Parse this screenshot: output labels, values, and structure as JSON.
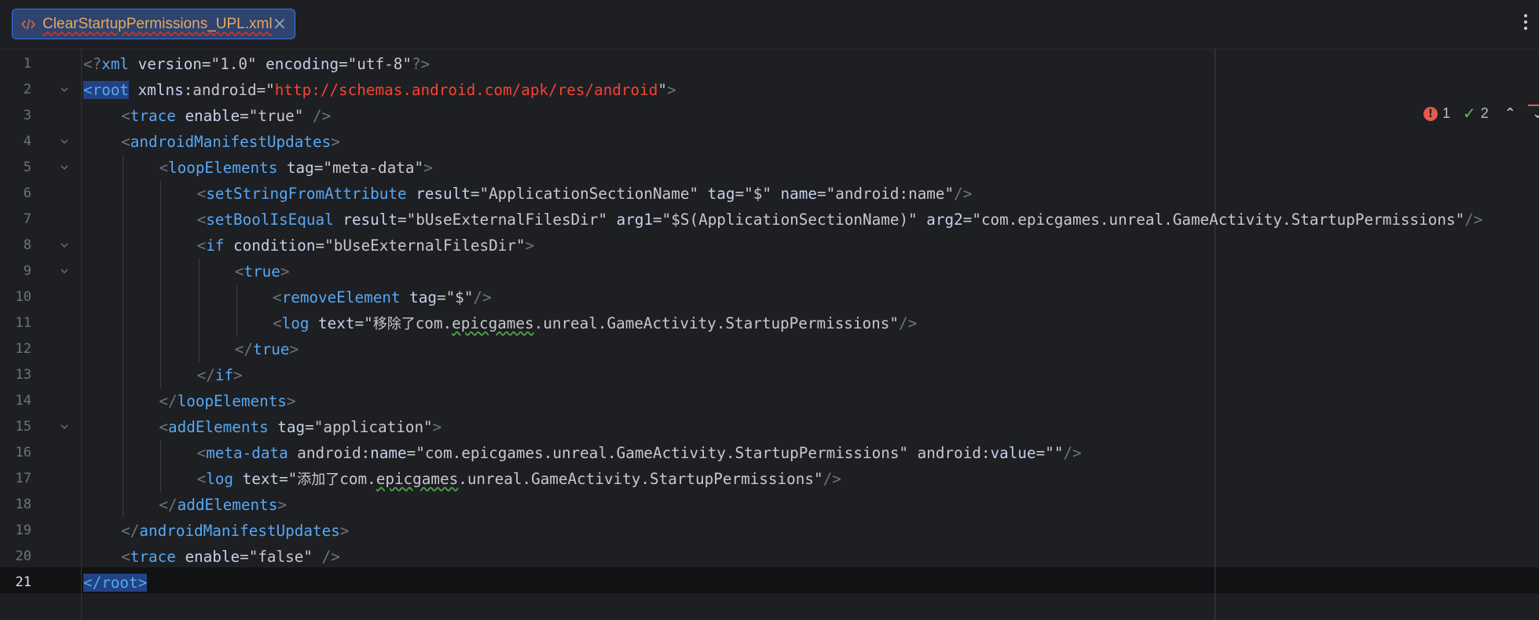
{
  "tab": {
    "title": "ClearStartupPermissions_UPL.xml",
    "close": "×"
  },
  "inspection": {
    "errors": "1",
    "warnings": "2",
    "error_glyph": "!",
    "ok_glyph": "✓",
    "prev": "⌃",
    "next": "⌄"
  },
  "colors": {
    "tag": "#56a8f5",
    "attr": "#c6d0ee",
    "value": "#c8c9cc",
    "url": "#f44336",
    "punct": "#6f737a",
    "selection": "#214283",
    "tab_title": "#e8a860"
  },
  "lines": [
    {
      "n": "1",
      "indent": 0,
      "fold": false,
      "cur": false,
      "tokens": [
        {
          "t": "<?",
          "c": "p"
        },
        {
          "t": "xml",
          "c": "t"
        },
        {
          "t": " version",
          "c": "a"
        },
        {
          "t": "=\"1.0\"",
          "c": "v"
        },
        {
          "t": " encoding",
          "c": "a"
        },
        {
          "t": "=\"utf-8\"",
          "c": "v"
        },
        {
          "t": "?>",
          "c": "p"
        }
      ]
    },
    {
      "n": "2",
      "indent": 0,
      "fold": true,
      "cur": false,
      "tokens": [
        {
          "t": "<root",
          "c": "t hl"
        },
        {
          "t": " xmlns",
          "c": "a"
        },
        {
          "t": ":android=\"",
          "c": "v"
        },
        {
          "t": "http://schemas.android.com/apk/res/android",
          "c": "url"
        },
        {
          "t": "\"",
          "c": "v"
        },
        {
          "t": ">",
          "c": "p"
        }
      ]
    },
    {
      "n": "3",
      "indent": 1,
      "fold": false,
      "cur": false,
      "tokens": [
        {
          "t": "<",
          "c": "p"
        },
        {
          "t": "trace",
          "c": "t"
        },
        {
          "t": " enable",
          "c": "a"
        },
        {
          "t": "=\"true\" ",
          "c": "v"
        },
        {
          "t": "/>",
          "c": "p"
        }
      ]
    },
    {
      "n": "4",
      "indent": 1,
      "fold": true,
      "cur": false,
      "tokens": [
        {
          "t": "<",
          "c": "p"
        },
        {
          "t": "androidManifestUpdates",
          "c": "t"
        },
        {
          "t": ">",
          "c": "p"
        }
      ]
    },
    {
      "n": "5",
      "indent": 2,
      "fold": true,
      "cur": false,
      "tokens": [
        {
          "t": "<",
          "c": "p"
        },
        {
          "t": "loopElements",
          "c": "t"
        },
        {
          "t": " tag",
          "c": "a"
        },
        {
          "t": "=\"meta-data\"",
          "c": "v"
        },
        {
          "t": ">",
          "c": "p"
        }
      ]
    },
    {
      "n": "6",
      "indent": 3,
      "fold": false,
      "cur": false,
      "tokens": [
        {
          "t": "<",
          "c": "p"
        },
        {
          "t": "setStringFromAttribute",
          "c": "t"
        },
        {
          "t": " result",
          "c": "a"
        },
        {
          "t": "=\"ApplicationSectionName\"",
          "c": "v"
        },
        {
          "t": " tag",
          "c": "a"
        },
        {
          "t": "=\"$\"",
          "c": "v"
        },
        {
          "t": " name",
          "c": "a"
        },
        {
          "t": "=\"android:name\"",
          "c": "v"
        },
        {
          "t": "/>",
          "c": "p"
        }
      ]
    },
    {
      "n": "7",
      "indent": 3,
      "fold": false,
      "cur": false,
      "tokens": [
        {
          "t": "<",
          "c": "p"
        },
        {
          "t": "setBoolIsEqual",
          "c": "t"
        },
        {
          "t": " result",
          "c": "a"
        },
        {
          "t": "=\"bUseExternalFilesDir\"",
          "c": "v"
        },
        {
          "t": " arg1",
          "c": "a"
        },
        {
          "t": "=\"$S(ApplicationSectionName)\"",
          "c": "v"
        },
        {
          "t": " arg2",
          "c": "a"
        },
        {
          "t": "=\"com.epicgames.unreal.GameActivity.StartupPermissions\"",
          "c": "v"
        },
        {
          "t": "/>",
          "c": "p"
        }
      ]
    },
    {
      "n": "8",
      "indent": 3,
      "fold": true,
      "cur": false,
      "tokens": [
        {
          "t": "<",
          "c": "p"
        },
        {
          "t": "if",
          "c": "t"
        },
        {
          "t": " condition",
          "c": "a"
        },
        {
          "t": "=\"bUseExternalFilesDir\"",
          "c": "v"
        },
        {
          "t": ">",
          "c": "p"
        }
      ]
    },
    {
      "n": "9",
      "indent": 4,
      "fold": true,
      "cur": false,
      "tokens": [
        {
          "t": "<",
          "c": "p"
        },
        {
          "t": "true",
          "c": "t"
        },
        {
          "t": ">",
          "c": "p"
        }
      ]
    },
    {
      "n": "10",
      "indent": 5,
      "fold": false,
      "cur": false,
      "tokens": [
        {
          "t": "<",
          "c": "p"
        },
        {
          "t": "removeElement",
          "c": "t"
        },
        {
          "t": " tag",
          "c": "a"
        },
        {
          "t": "=\"$\"",
          "c": "v"
        },
        {
          "t": "/>",
          "c": "p"
        }
      ]
    },
    {
      "n": "11",
      "indent": 5,
      "fold": false,
      "cur": false,
      "tokens": [
        {
          "t": "<",
          "c": "p"
        },
        {
          "t": "log",
          "c": "t"
        },
        {
          "t": " text",
          "c": "a"
        },
        {
          "t": "=\"",
          "c": "v"
        },
        {
          "t": "移除了",
          "c": "v cjk"
        },
        {
          "t": "com.",
          "c": "v"
        },
        {
          "t": "epicgames",
          "c": "v wavy"
        },
        {
          "t": ".unreal.GameActivity.StartupPermissions\"",
          "c": "v"
        },
        {
          "t": "/>",
          "c": "p"
        }
      ]
    },
    {
      "n": "12",
      "indent": 4,
      "fold": false,
      "cur": false,
      "tokens": [
        {
          "t": "</",
          "c": "p"
        },
        {
          "t": "true",
          "c": "t"
        },
        {
          "t": ">",
          "c": "p"
        }
      ]
    },
    {
      "n": "13",
      "indent": 3,
      "fold": false,
      "cur": false,
      "tokens": [
        {
          "t": "</",
          "c": "p"
        },
        {
          "t": "if",
          "c": "t"
        },
        {
          "t": ">",
          "c": "p"
        }
      ]
    },
    {
      "n": "14",
      "indent": 2,
      "fold": false,
      "cur": false,
      "tokens": [
        {
          "t": "</",
          "c": "p"
        },
        {
          "t": "loopElements",
          "c": "t"
        },
        {
          "t": ">",
          "c": "p"
        }
      ]
    },
    {
      "n": "15",
      "indent": 2,
      "fold": true,
      "cur": false,
      "tokens": [
        {
          "t": "<",
          "c": "p"
        },
        {
          "t": "addElements",
          "c": "t"
        },
        {
          "t": " tag",
          "c": "a"
        },
        {
          "t": "=\"application\"",
          "c": "v"
        },
        {
          "t": ">",
          "c": "p"
        }
      ]
    },
    {
      "n": "16",
      "indent": 3,
      "fold": false,
      "cur": false,
      "tokens": [
        {
          "t": "<",
          "c": "p"
        },
        {
          "t": "meta-data",
          "c": "t"
        },
        {
          "t": " android:",
          "c": "v"
        },
        {
          "t": "name",
          "c": "a"
        },
        {
          "t": "=\"com.epicgames.unreal.GameActivity.StartupPermissions\"",
          "c": "v"
        },
        {
          "t": " android:",
          "c": "v"
        },
        {
          "t": "value",
          "c": "a"
        },
        {
          "t": "=\"\"",
          "c": "v"
        },
        {
          "t": "/>",
          "c": "p"
        }
      ]
    },
    {
      "n": "17",
      "indent": 3,
      "fold": false,
      "cur": false,
      "tokens": [
        {
          "t": "<",
          "c": "p"
        },
        {
          "t": "log",
          "c": "t"
        },
        {
          "t": " text",
          "c": "a"
        },
        {
          "t": "=\"",
          "c": "v"
        },
        {
          "t": "添加了",
          "c": "v cjk"
        },
        {
          "t": "com.",
          "c": "v"
        },
        {
          "t": "epicgames",
          "c": "v wavy"
        },
        {
          "t": ".unreal.GameActivity.StartupPermissions\"",
          "c": "v"
        },
        {
          "t": "/>",
          "c": "p"
        }
      ]
    },
    {
      "n": "18",
      "indent": 2,
      "fold": false,
      "cur": false,
      "tokens": [
        {
          "t": "</",
          "c": "p"
        },
        {
          "t": "addElements",
          "c": "t"
        },
        {
          "t": ">",
          "c": "p"
        }
      ]
    },
    {
      "n": "19",
      "indent": 1,
      "fold": false,
      "cur": false,
      "tokens": [
        {
          "t": "</",
          "c": "p"
        },
        {
          "t": "androidManifestUpdates",
          "c": "t"
        },
        {
          "t": ">",
          "c": "p"
        }
      ]
    },
    {
      "n": "20",
      "indent": 1,
      "fold": false,
      "cur": false,
      "tokens": [
        {
          "t": "<",
          "c": "p"
        },
        {
          "t": "trace",
          "c": "t"
        },
        {
          "t": " enable",
          "c": "a"
        },
        {
          "t": "=\"false\" ",
          "c": "v"
        },
        {
          "t": "/>",
          "c": "p"
        }
      ]
    },
    {
      "n": "21",
      "indent": 0,
      "fold": false,
      "cur": true,
      "tokens": [
        {
          "t": "</root>",
          "c": "t hl"
        }
      ]
    }
  ]
}
